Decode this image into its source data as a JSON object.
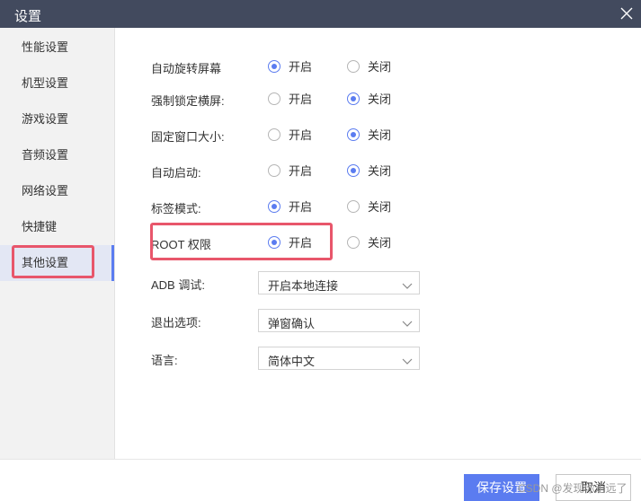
{
  "window": {
    "title": "设置"
  },
  "sidebar": {
    "items": [
      {
        "label": "性能设置"
      },
      {
        "label": "机型设置"
      },
      {
        "label": "游戏设置"
      },
      {
        "label": "音频设置"
      },
      {
        "label": "网络设置"
      },
      {
        "label": "快捷键"
      },
      {
        "label": "其他设置",
        "selected": true
      }
    ]
  },
  "options": {
    "on_label": "开启",
    "off_label": "关闭",
    "rows": [
      {
        "label": "自动旋转屏幕",
        "value": "on"
      },
      {
        "label": "强制锁定横屏:",
        "value": "off"
      },
      {
        "label": "固定窗口大小:",
        "value": "off"
      },
      {
        "label": "自动启动:",
        "value": "off"
      },
      {
        "label": "标签模式:",
        "value": "on"
      },
      {
        "label": "ROOT 权限",
        "value": "on"
      }
    ]
  },
  "selects": [
    {
      "label": "ADB 调试:",
      "value": "开启本地连接"
    },
    {
      "label": "退出选项:",
      "value": "弹窗确认"
    },
    {
      "label": "语言:",
      "value": "简体中文"
    }
  ],
  "footer": {
    "save_label": "保存设置",
    "cancel_label": "取消"
  },
  "watermark": "CSDN @发现你走远了",
  "colors": {
    "accent": "#5b7cf0",
    "highlight": "#e8566b",
    "titlebar": "#424a5e"
  }
}
